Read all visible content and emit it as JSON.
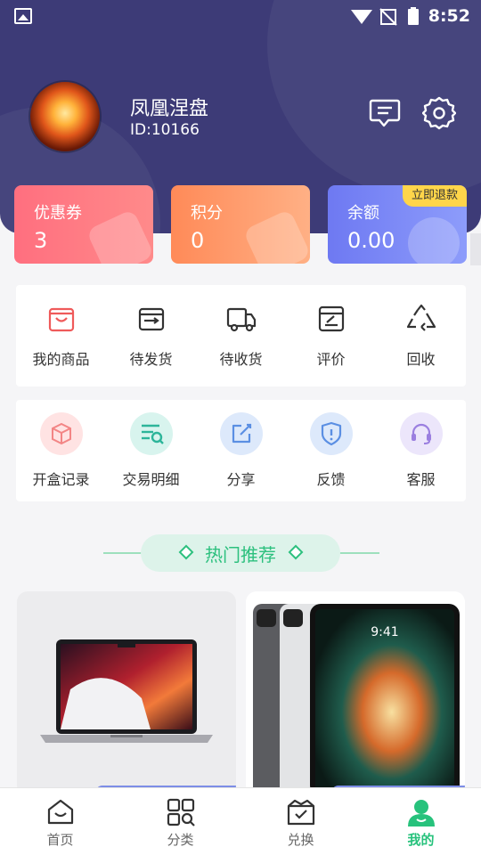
{
  "status_bar": {
    "time": "8:52"
  },
  "profile": {
    "name": "凤凰涅盘",
    "id_text": "ID:10166"
  },
  "stats": [
    {
      "label": "优惠券",
      "value": "3"
    },
    {
      "label": "积分",
      "value": "0"
    },
    {
      "label": "余额",
      "value": "0.00",
      "badge": "立即退款"
    }
  ],
  "orders": [
    {
      "label": "我的商品",
      "icon": "shopping-bag-icon"
    },
    {
      "label": "待发货",
      "icon": "ship-box-icon"
    },
    {
      "label": "待收货",
      "icon": "truck-icon"
    },
    {
      "label": "评价",
      "icon": "review-icon"
    },
    {
      "label": "回收",
      "icon": "recycle-icon"
    }
  ],
  "services": [
    {
      "label": "开盒记录",
      "icon": "box-icon",
      "color": "#ffe3e3"
    },
    {
      "label": "交易明细",
      "icon": "list-search-icon",
      "color": "#d8f4ee"
    },
    {
      "label": "分享",
      "icon": "share-icon",
      "color": "#dde9fb"
    },
    {
      "label": "反馈",
      "icon": "shield-alert-icon",
      "color": "#dde9fb"
    },
    {
      "label": "客服",
      "icon": "headset-icon",
      "color": "#ece6fb"
    }
  ],
  "section_title": "热门推荐",
  "screen_time": "9:41",
  "tabs": [
    {
      "label": "首页",
      "icon": "home-icon"
    },
    {
      "label": "分类",
      "icon": "category-icon"
    },
    {
      "label": "兑换",
      "icon": "exchange-icon"
    },
    {
      "label": "我的",
      "icon": "user-icon",
      "active": true
    }
  ],
  "colors": {
    "header": "#3d3b77",
    "accent_green": "#27c27c"
  }
}
